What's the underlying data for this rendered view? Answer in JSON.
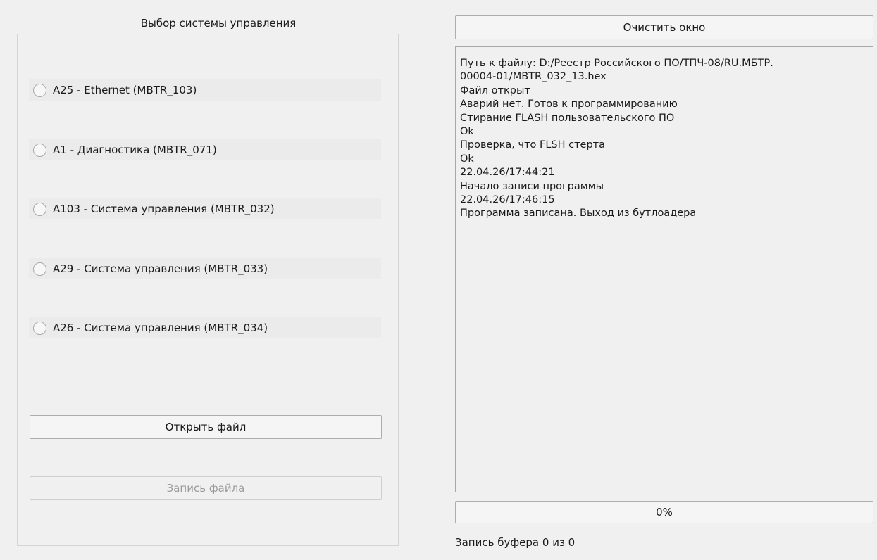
{
  "left_panel": {
    "title": "Выбор системы управления",
    "options": [
      {
        "label": "A25 - Ethernet (MBTR_103)",
        "selected": false
      },
      {
        "label": "A1 - Диагностика (MBTR_071)",
        "selected": false
      },
      {
        "label": "A103 - Система управления (MBTR_032)",
        "selected": false
      },
      {
        "label": "A29 - Система управления (MBTR_033)",
        "selected": false
      },
      {
        "label": "A26 - Система управления (MBTR_034)",
        "selected": false
      }
    ],
    "open_file_label": "Открыть файл",
    "write_file_label": "Запись файла"
  },
  "right_panel": {
    "clear_button_label": "Очистить окно",
    "log_lines": [
      "Путь к файлу: D:/Реестр Российского ПО/ТПЧ-08/RU.МБТР.",
      "00004-01/MBTR_032_13.hex",
      "Файл открыт",
      "Аварий нет. Готов к программированию",
      "Стирание FLASH пользовательского ПО",
      "Ok",
      "Проверка, что FLSH стерта",
      "Ok",
      "22.04.26/17:44:21",
      "Начало записи программы",
      "22.04.26/17:46:15",
      "Программа записана. Выход из бутлоадера"
    ],
    "progress": {
      "value_percent": 0,
      "text": "0%"
    },
    "status": "Запись буфера 0 из 0"
  },
  "colors": {
    "window_bg": "#f0f0f0",
    "progress_fill": "#06b025"
  }
}
